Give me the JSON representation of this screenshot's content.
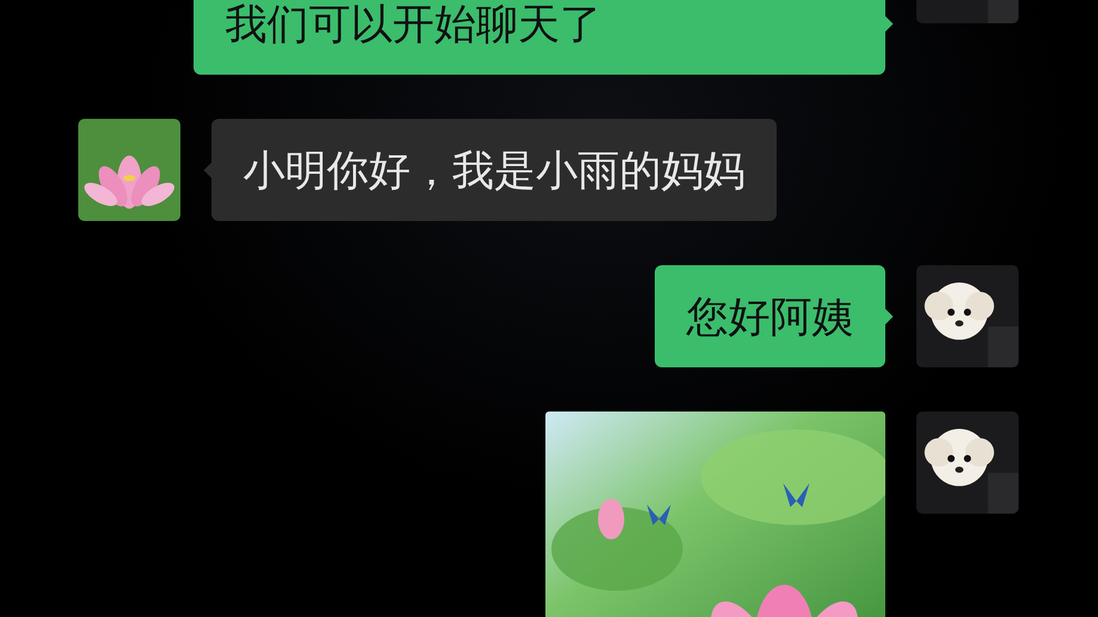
{
  "messages": [
    {
      "side": "right",
      "kind": "text",
      "text": "我们可以开始聊天了"
    },
    {
      "side": "left",
      "kind": "text",
      "text": "小明你好，我是小雨的妈妈"
    },
    {
      "side": "right",
      "kind": "text",
      "text": "您好阿姨"
    },
    {
      "side": "right",
      "kind": "image"
    }
  ]
}
